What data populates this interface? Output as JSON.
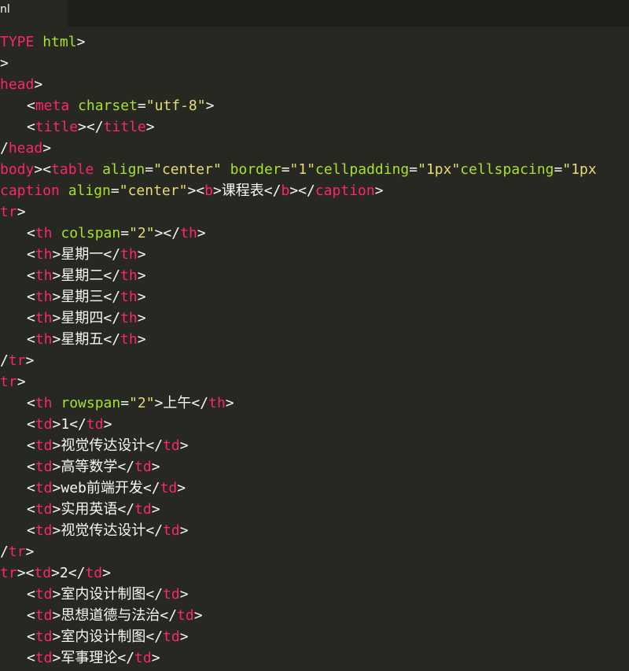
{
  "tab": {
    "title": "nl"
  },
  "lines": [
    [
      [
        "tg",
        "TYPE"
      ],
      [
        "tx",
        " "
      ],
      [
        "at",
        "html"
      ],
      [
        "tx",
        ">"
      ]
    ],
    [
      [
        "tx",
        ">"
      ]
    ],
    [
      [
        "tg",
        "head"
      ],
      [
        "tx",
        ">"
      ]
    ],
    [
      [
        "ind",
        ""
      ],
      [
        "tx",
        "<"
      ],
      [
        "tg",
        "meta"
      ],
      [
        "tx",
        " "
      ],
      [
        "at",
        "charset"
      ],
      [
        "tx",
        "="
      ],
      [
        "st",
        "\"utf-8\""
      ],
      [
        "tx",
        ">"
      ]
    ],
    [
      [
        "ind",
        ""
      ],
      [
        "tx",
        "<"
      ],
      [
        "tg",
        "title"
      ],
      [
        "tx",
        "></"
      ],
      [
        "tg",
        "title"
      ],
      [
        "tx",
        ">"
      ]
    ],
    [
      [
        "tx",
        "/"
      ],
      [
        "tg",
        "head"
      ],
      [
        "tx",
        ">"
      ]
    ],
    [
      [
        "tg",
        "body"
      ],
      [
        "tx",
        ">"
      ],
      [
        "tx",
        "<"
      ],
      [
        "tg",
        "table"
      ],
      [
        "tx",
        " "
      ],
      [
        "at",
        "align"
      ],
      [
        "tx",
        "="
      ],
      [
        "st",
        "\"center\""
      ],
      [
        "tx",
        " "
      ],
      [
        "at",
        "border"
      ],
      [
        "tx",
        "="
      ],
      [
        "st",
        "\"1\""
      ],
      [
        "at",
        "cellpadding"
      ],
      [
        "tx",
        "="
      ],
      [
        "st",
        "\"1px\""
      ],
      [
        "at",
        "cellspacing"
      ],
      [
        "tx",
        "="
      ],
      [
        "st",
        "\"1px"
      ]
    ],
    [
      [
        "tg",
        "caption"
      ],
      [
        "tx",
        " "
      ],
      [
        "at",
        "align"
      ],
      [
        "tx",
        "="
      ],
      [
        "st",
        "\"center\""
      ],
      [
        "tx",
        "><"
      ],
      [
        "tg",
        "b"
      ],
      [
        "tx",
        ">课程表</"
      ],
      [
        "tg",
        "b"
      ],
      [
        "tx",
        "></"
      ],
      [
        "tg",
        "caption"
      ],
      [
        "tx",
        ">"
      ]
    ],
    [
      [
        "tg",
        "tr"
      ],
      [
        "tx",
        ">"
      ]
    ],
    [
      [
        "ind",
        ""
      ],
      [
        "tx",
        "<"
      ],
      [
        "tg",
        "th"
      ],
      [
        "tx",
        " "
      ],
      [
        "at",
        "colspan"
      ],
      [
        "tx",
        "="
      ],
      [
        "st",
        "\"2\""
      ],
      [
        "tx",
        "></"
      ],
      [
        "tg",
        "th"
      ],
      [
        "tx",
        ">"
      ]
    ],
    [
      [
        "ind",
        ""
      ],
      [
        "tx",
        "<"
      ],
      [
        "tg",
        "th"
      ],
      [
        "tx",
        ">星期一</"
      ],
      [
        "tg",
        "th"
      ],
      [
        "tx",
        ">"
      ]
    ],
    [
      [
        "ind",
        ""
      ],
      [
        "tx",
        "<"
      ],
      [
        "tg",
        "th"
      ],
      [
        "tx",
        ">星期二</"
      ],
      [
        "tg",
        "th"
      ],
      [
        "tx",
        ">"
      ]
    ],
    [
      [
        "ind",
        ""
      ],
      [
        "tx",
        "<"
      ],
      [
        "tg",
        "th"
      ],
      [
        "tx",
        ">星期三</"
      ],
      [
        "tg",
        "th"
      ],
      [
        "tx",
        ">"
      ]
    ],
    [
      [
        "ind",
        ""
      ],
      [
        "tx",
        "<"
      ],
      [
        "tg",
        "th"
      ],
      [
        "tx",
        ">星期四</"
      ],
      [
        "tg",
        "th"
      ],
      [
        "tx",
        ">"
      ]
    ],
    [
      [
        "ind",
        ""
      ],
      [
        "tx",
        "<"
      ],
      [
        "tg",
        "th"
      ],
      [
        "tx",
        ">星期五</"
      ],
      [
        "tg",
        "th"
      ],
      [
        "tx",
        ">"
      ]
    ],
    [
      [
        "tx",
        "/"
      ],
      [
        "tg",
        "tr"
      ],
      [
        "tx",
        ">"
      ]
    ],
    [
      [
        "tg",
        "tr"
      ],
      [
        "tx",
        ">"
      ]
    ],
    [
      [
        "ind",
        ""
      ],
      [
        "tx",
        "<"
      ],
      [
        "tg",
        "th"
      ],
      [
        "tx",
        " "
      ],
      [
        "at",
        "rowspan"
      ],
      [
        "tx",
        "="
      ],
      [
        "st",
        "\"2\""
      ],
      [
        "tx",
        ">上午</"
      ],
      [
        "tg",
        "th"
      ],
      [
        "tx",
        ">"
      ]
    ],
    [
      [
        "ind",
        ""
      ],
      [
        "tx",
        "<"
      ],
      [
        "tg",
        "td"
      ],
      [
        "tx",
        ">1</"
      ],
      [
        "tg",
        "td"
      ],
      [
        "tx",
        ">"
      ]
    ],
    [
      [
        "ind",
        ""
      ],
      [
        "tx",
        "<"
      ],
      [
        "tg",
        "td"
      ],
      [
        "tx",
        ">视觉传达设计</"
      ],
      [
        "tg",
        "td"
      ],
      [
        "tx",
        ">"
      ]
    ],
    [
      [
        "ind",
        ""
      ],
      [
        "tx",
        "<"
      ],
      [
        "tg",
        "td"
      ],
      [
        "tx",
        ">高等数学</"
      ],
      [
        "tg",
        "td"
      ],
      [
        "tx",
        ">"
      ]
    ],
    [
      [
        "ind",
        ""
      ],
      [
        "tx",
        "<"
      ],
      [
        "tg",
        "td"
      ],
      [
        "tx",
        ">web前端开发</"
      ],
      [
        "tg",
        "td"
      ],
      [
        "tx",
        ">"
      ]
    ],
    [
      [
        "ind",
        ""
      ],
      [
        "tx",
        "<"
      ],
      [
        "tg",
        "td"
      ],
      [
        "tx",
        ">实用英语</"
      ],
      [
        "tg",
        "td"
      ],
      [
        "tx",
        ">"
      ]
    ],
    [
      [
        "ind",
        ""
      ],
      [
        "tx",
        "<"
      ],
      [
        "tg",
        "td"
      ],
      [
        "tx",
        ">视觉传达设计</"
      ],
      [
        "tg",
        "td"
      ],
      [
        "tx",
        ">"
      ]
    ],
    [
      [
        "tx",
        "/"
      ],
      [
        "tg",
        "tr"
      ],
      [
        "tx",
        ">"
      ]
    ],
    [
      [
        "tg",
        "tr"
      ],
      [
        "tx",
        "><"
      ],
      [
        "tg",
        "td"
      ],
      [
        "tx",
        ">2</"
      ],
      [
        "tg",
        "td"
      ],
      [
        "tx",
        ">"
      ]
    ],
    [
      [
        "ind",
        ""
      ],
      [
        "tx",
        "<"
      ],
      [
        "tg",
        "td"
      ],
      [
        "tx",
        ">室内设计制图</"
      ],
      [
        "tg",
        "td"
      ],
      [
        "tx",
        ">"
      ]
    ],
    [
      [
        "ind",
        ""
      ],
      [
        "tx",
        "<"
      ],
      [
        "tg",
        "td"
      ],
      [
        "tx",
        ">思想道德与法治</"
      ],
      [
        "tg",
        "td"
      ],
      [
        "tx",
        ">"
      ]
    ],
    [
      [
        "ind",
        ""
      ],
      [
        "tx",
        "<"
      ],
      [
        "tg",
        "td"
      ],
      [
        "tx",
        ">室内设计制图</"
      ],
      [
        "tg",
        "td"
      ],
      [
        "tx",
        ">"
      ]
    ],
    [
      [
        "ind",
        ""
      ],
      [
        "tx",
        "<"
      ],
      [
        "tg",
        "td"
      ],
      [
        "tx",
        ">军事理论</"
      ],
      [
        "tg",
        "td"
      ],
      [
        "tx",
        ">"
      ]
    ]
  ],
  "colors": {
    "background": "#272822",
    "tag": "#f92672",
    "attribute": "#a6e22e",
    "string": "#e6db74",
    "text": "#f8f8f2"
  }
}
